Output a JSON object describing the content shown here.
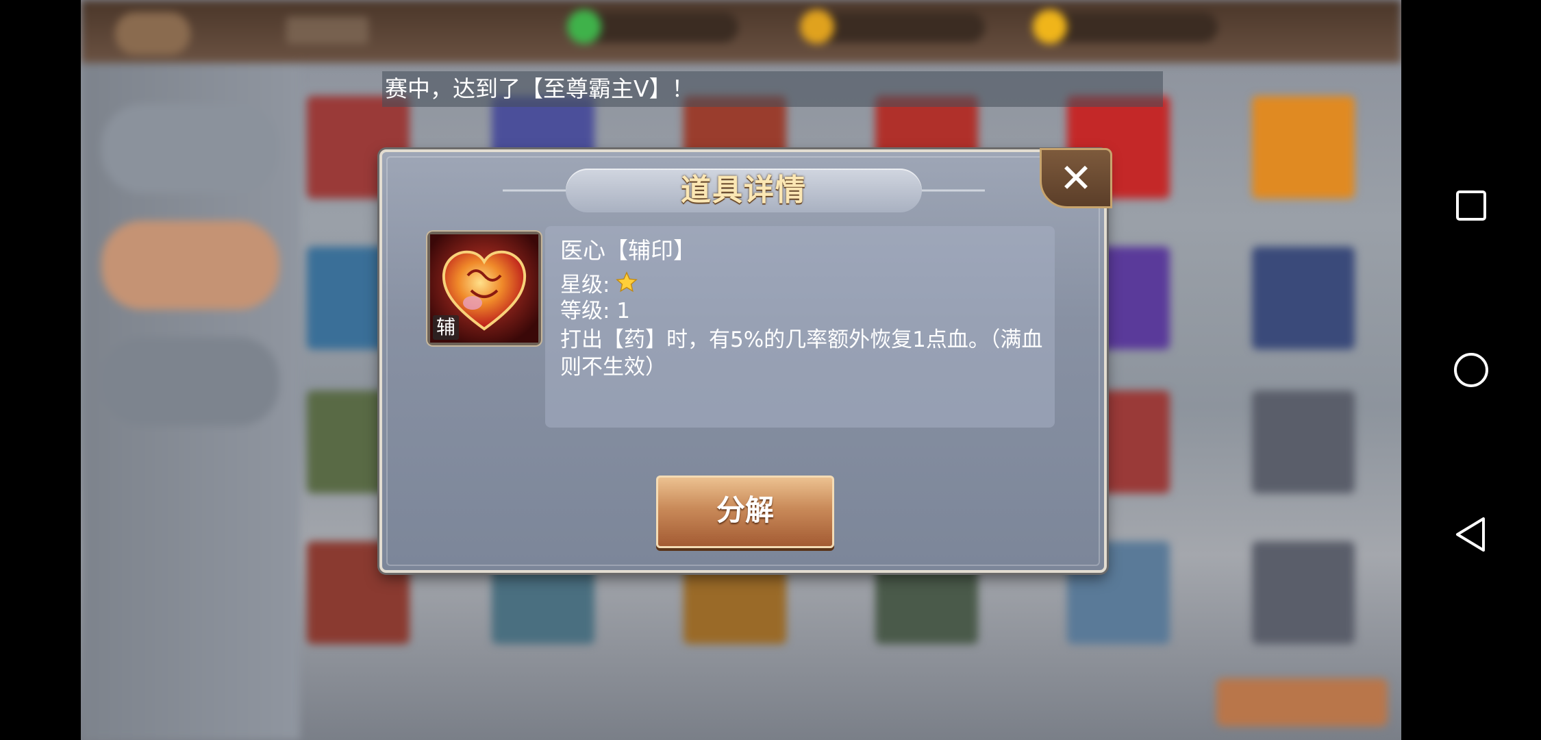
{
  "ticker": {
    "text": "赛中，达到了【至尊霸主V】！"
  },
  "dialog": {
    "title": "道具详情",
    "close_symbol": "✕",
    "item": {
      "icon": "heart-icon",
      "tag": "辅",
      "name": "医心【辅印】",
      "star_label": "星级:",
      "stars": 1,
      "level_label": "等级: 1",
      "description": "打出【药】时，有5%的几率额外恢复1点血。（满血则不生效）"
    },
    "decompose_label": "分解"
  },
  "navigation": {
    "icons": [
      "square-recents-icon",
      "circle-home-icon",
      "triangle-back-icon"
    ]
  },
  "colors": {
    "dialog_bg": "#8891a3",
    "title_text": "#fbe7b4",
    "button": "#c98a59",
    "close_button": "#6b4a2f"
  }
}
